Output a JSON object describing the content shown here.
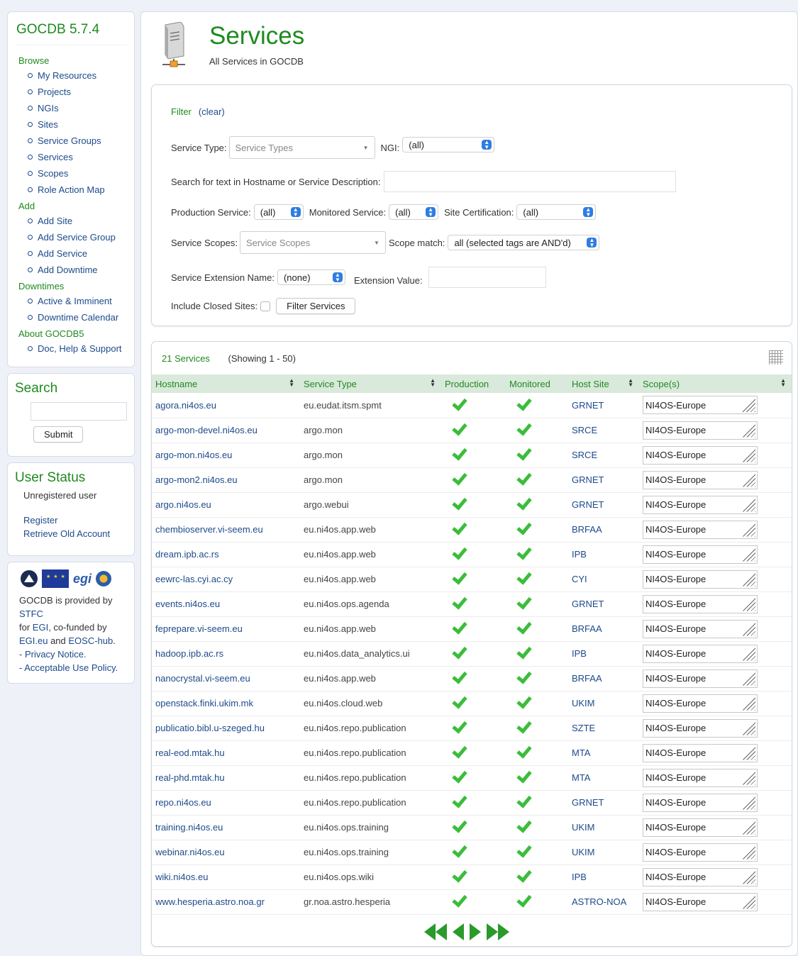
{
  "sidebar": {
    "app_title": "GOCDB 5.7.4",
    "sections": [
      {
        "heading": "Browse",
        "items": [
          "My Resources",
          "Projects",
          "NGIs",
          "Sites",
          "Service Groups",
          "Services",
          "Scopes",
          "Role Action Map"
        ]
      },
      {
        "heading": "Add",
        "items": [
          "Add Site",
          "Add Service Group",
          "Add Service",
          "Add Downtime"
        ]
      },
      {
        "heading": "Downtimes",
        "items": [
          "Active & Imminent",
          "Downtime Calendar"
        ]
      },
      {
        "heading": "About GOCDB5",
        "items": [
          "Doc, Help & Support"
        ]
      }
    ],
    "search": {
      "title": "Search",
      "submit_label": "Submit"
    },
    "user_status": {
      "title": "User Status",
      "status": "Unregistered user",
      "register_label": "Register",
      "retrieve_label": "Retrieve Old Account"
    },
    "footer": {
      "line1_prefix": "GOCDB is provided by ",
      "stfc": "STFC",
      "line2_prefix": "for ",
      "egi": "EGI",
      "line2_suffix": ", co-funded by",
      "egi_eu": "EGI.eu",
      "and": " and ",
      "eosc": "EOSC-hub",
      "period": ".",
      "privacy": "- Privacy Notice.",
      "aup": "- Acceptable Use Policy.",
      "logo_egi_text": "egi"
    }
  },
  "header": {
    "title": "Services",
    "subtitle": "All Services in GOCDB"
  },
  "filter": {
    "filter_label": "Filter",
    "clear_label": "(clear)",
    "service_type_label": "Service Type:",
    "service_type_placeholder": "Service Types",
    "ngi_label": "NGI:",
    "ngi_value": "(all)",
    "search_label": "Search for text in Hostname or Service Description:",
    "production_label": "Production Service:",
    "production_value": "(all)",
    "monitored_label": "Monitored Service:",
    "monitored_value": "(all)",
    "certification_label": "Site Certification:",
    "certification_value": "(all)",
    "scopes_label": "Service Scopes:",
    "scopes_placeholder": "Service Scopes",
    "scope_match_label": "Scope match:",
    "scope_match_value": "all (selected tags are AND'd)",
    "extension_name_label": "Service Extension Name:",
    "extension_name_value": "(none)",
    "extension_value_label": "Extension Value:",
    "closed_sites_label": "Include Closed Sites:",
    "filter_button": "Filter Services"
  },
  "results": {
    "count_label": "21 Services",
    "showing_label": "(Showing 1 - 50)",
    "columns": [
      "Hostname",
      "Service Type",
      "Production",
      "Monitored",
      "Host Site",
      "Scope(s)"
    ],
    "rows": [
      {
        "host": "agora.ni4os.eu",
        "type": "eu.eudat.itsm.spmt",
        "site": "GRNET",
        "scope": "NI4OS-Europe"
      },
      {
        "host": "argo-mon-devel.ni4os.eu",
        "type": "argo.mon",
        "site": "SRCE",
        "scope": "NI4OS-Europe"
      },
      {
        "host": "argo-mon.ni4os.eu",
        "type": "argo.mon",
        "site": "SRCE",
        "scope": "NI4OS-Europe"
      },
      {
        "host": "argo-mon2.ni4os.eu",
        "type": "argo.mon",
        "site": "GRNET",
        "scope": "NI4OS-Europe"
      },
      {
        "host": "argo.ni4os.eu",
        "type": "argo.webui",
        "site": "GRNET",
        "scope": "NI4OS-Europe"
      },
      {
        "host": "chembioserver.vi-seem.eu",
        "type": "eu.ni4os.app.web",
        "site": "BRFAA",
        "scope": "NI4OS-Europe"
      },
      {
        "host": "dream.ipb.ac.rs",
        "type": "eu.ni4os.app.web",
        "site": "IPB",
        "scope": "NI4OS-Europe"
      },
      {
        "host": "eewrc-las.cyi.ac.cy",
        "type": "eu.ni4os.app.web",
        "site": "CYI",
        "scope": "NI4OS-Europe"
      },
      {
        "host": "events.ni4os.eu",
        "type": "eu.ni4os.ops.agenda",
        "site": "GRNET",
        "scope": "NI4OS-Europe"
      },
      {
        "host": "feprepare.vi-seem.eu",
        "type": "eu.ni4os.app.web",
        "site": "BRFAA",
        "scope": "NI4OS-Europe"
      },
      {
        "host": "hadoop.ipb.ac.rs",
        "type": "eu.ni4os.data_analytics.ui",
        "site": "IPB",
        "scope": "NI4OS-Europe"
      },
      {
        "host": "nanocrystal.vi-seem.eu",
        "type": "eu.ni4os.app.web",
        "site": "BRFAA",
        "scope": "NI4OS-Europe"
      },
      {
        "host": "openstack.finki.ukim.mk",
        "type": "eu.ni4os.cloud.web",
        "site": "UKIM",
        "scope": "NI4OS-Europe"
      },
      {
        "host": "publicatio.bibl.u-szeged.hu",
        "type": "eu.ni4os.repo.publication",
        "site": "SZTE",
        "scope": "NI4OS-Europe"
      },
      {
        "host": "real-eod.mtak.hu",
        "type": "eu.ni4os.repo.publication",
        "site": "MTA",
        "scope": "NI4OS-Europe"
      },
      {
        "host": "real-phd.mtak.hu",
        "type": "eu.ni4os.repo.publication",
        "site": "MTA",
        "scope": "NI4OS-Europe"
      },
      {
        "host": "repo.ni4os.eu",
        "type": "eu.ni4os.repo.publication",
        "site": "GRNET",
        "scope": "NI4OS-Europe"
      },
      {
        "host": "training.ni4os.eu",
        "type": "eu.ni4os.ops.training",
        "site": "UKIM",
        "scope": "NI4OS-Europe"
      },
      {
        "host": "webinar.ni4os.eu",
        "type": "eu.ni4os.ops.training",
        "site": "UKIM",
        "scope": "NI4OS-Europe"
      },
      {
        "host": "wiki.ni4os.eu",
        "type": "eu.ni4os.ops.wiki",
        "site": "IPB",
        "scope": "NI4OS-Europe"
      },
      {
        "host": "www.hesperia.astro.noa.gr",
        "type": "gr.noa.astro.hesperia",
        "site": "ASTRO-NOA",
        "scope": "NI4OS-Europe"
      }
    ]
  },
  "colors": {
    "brand_green": "#1f8a1f",
    "link_blue": "#1d4a8a",
    "check_green": "#3bbd3b",
    "header_row": "#d9e9db"
  }
}
